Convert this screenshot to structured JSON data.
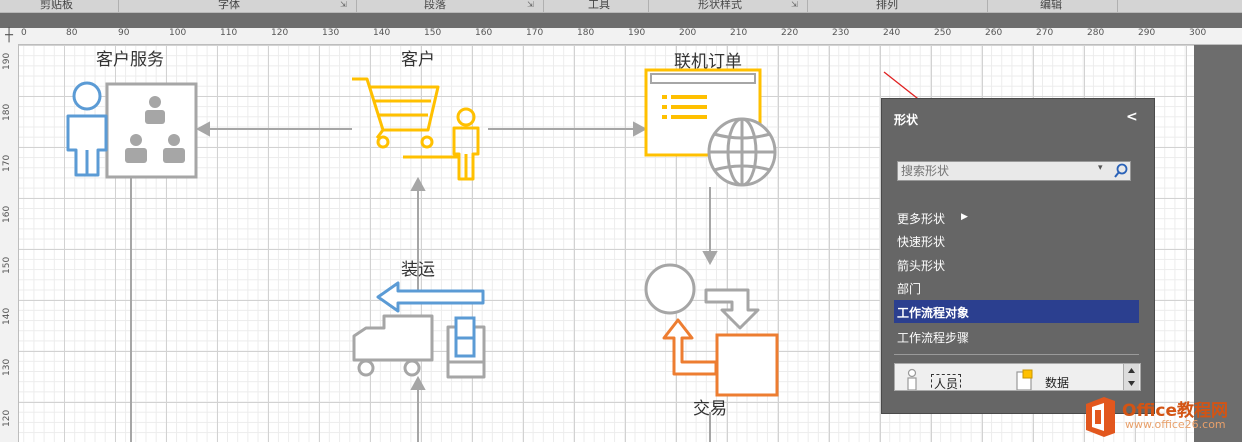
{
  "ribbon": {
    "groups": [
      "剪贴板",
      "字体",
      "段落",
      "工具",
      "形状样式",
      "排列",
      "编辑"
    ]
  },
  "ruler": {
    "horizontal": [
      "0",
      "80",
      "90",
      "100",
      "110",
      "120",
      "130",
      "140",
      "150",
      "160",
      "170",
      "180",
      "190",
      "200",
      "210",
      "220",
      "230",
      "240",
      "250",
      "260",
      "270",
      "280",
      "290",
      "300"
    ],
    "vertical": [
      "190",
      "180",
      "170",
      "160",
      "150",
      "140",
      "130",
      "120"
    ]
  },
  "diagram": {
    "labels": {
      "customer_service": "客户服务",
      "customer": "客户",
      "online_order": "联机订单",
      "shipping": "装运",
      "transaction": "交易"
    },
    "colors": {
      "blue": "#5b9bd5",
      "gray": "#a6a6a6",
      "yellow": "#ffc000",
      "orange": "#ed7d31",
      "arrow": "#a6a6a6"
    }
  },
  "shapes_panel": {
    "title": "形状",
    "collapse_icon": "chevron-left-icon",
    "search_placeholder": "搜索形状",
    "items": [
      "更多形状",
      "快速形状",
      "箭头形状",
      "部门",
      "工作流程对象",
      "工作流程步骤"
    ],
    "selected_item": "工作流程对象",
    "stencil_shapes": [
      "人员",
      "数据"
    ]
  },
  "watermark": {
    "brand": "Office教程网",
    "url": "www.office26.com"
  }
}
